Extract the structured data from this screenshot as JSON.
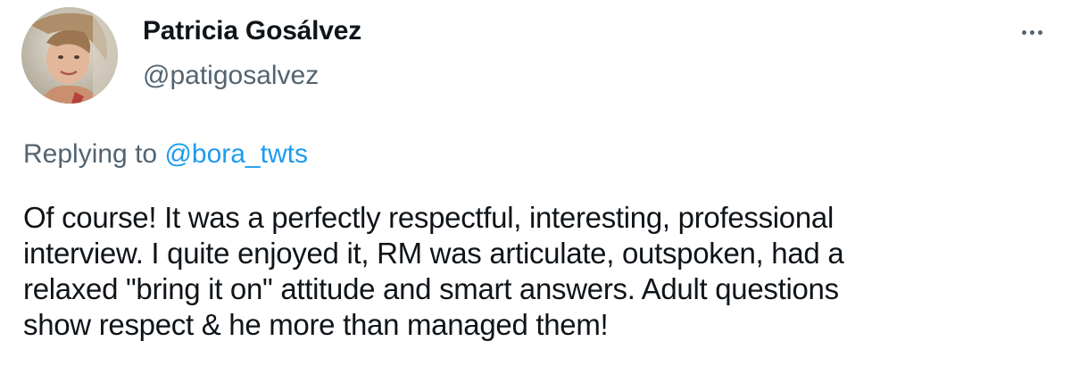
{
  "author": {
    "display_name": "Patricia Gosálvez",
    "handle": "@patigosalvez",
    "avatar_icon": "avatar-photo"
  },
  "header": {
    "more_icon": "more-dots-icon"
  },
  "reply": {
    "prefix": "Replying to",
    "mention": "@bora_twts"
  },
  "tweet": {
    "lines": [
      "Of course! It was a perfectly respectful, interesting, professional",
      "interview. I quite enjoyed it, RM was articulate, outspoken, had a",
      "relaxed \"bring it on\" attitude and smart answers. Adult questions",
      "show respect & he more than managed them!"
    ]
  },
  "colors": {
    "text": "#0f1419",
    "muted": "#536471",
    "link": "#1d9bf0"
  }
}
